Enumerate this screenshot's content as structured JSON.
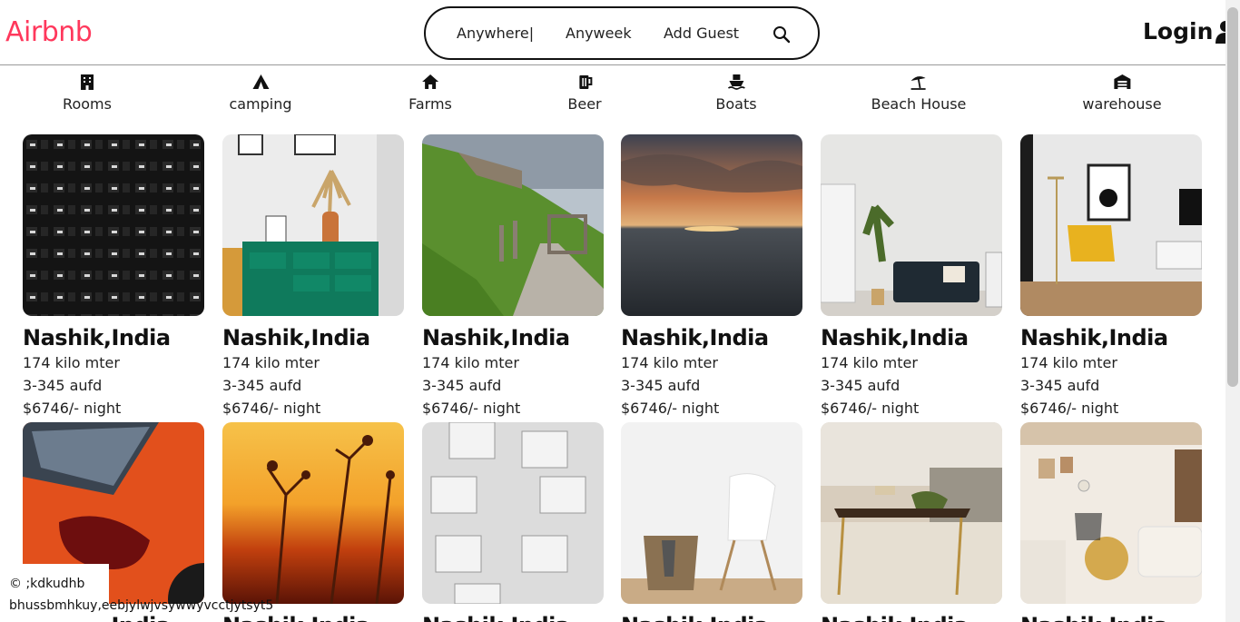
{
  "header": {
    "logo": "Airbnb",
    "search": {
      "anywhere": "Anywhere|",
      "anyweek": "Anyweek",
      "guest": "Add Guest"
    },
    "login": "Login"
  },
  "categories": [
    {
      "label": "Rooms",
      "icon": "building-icon"
    },
    {
      "label": "camping",
      "icon": "tent-icon"
    },
    {
      "label": "Farms",
      "icon": "house-icon"
    },
    {
      "label": "Beer",
      "icon": "mug-icon"
    },
    {
      "label": "Boats",
      "icon": "boat-icon"
    },
    {
      "label": "Beach House",
      "icon": "umbrella-icon"
    },
    {
      "label": "warehouse",
      "icon": "warehouse-icon"
    }
  ],
  "listings": [
    {
      "title": "Nashik,India",
      "distance": "174 kilo mter",
      "dates": "3-345 aufd",
      "price": "$6746/- night",
      "image": "dark-building"
    },
    {
      "title": "Nashik,India",
      "distance": "174 kilo mter",
      "dates": "3-345 aufd",
      "price": "$6746/- night",
      "image": "green-cabinet"
    },
    {
      "title": "Nashik,India",
      "distance": "174 kilo mter",
      "dates": "3-345 aufd",
      "price": "$6746/- night",
      "image": "hill-ruins"
    },
    {
      "title": "Nashik,India",
      "distance": "174 kilo mter",
      "dates": "3-345 aufd",
      "price": "$6746/- night",
      "image": "ocean-sunset"
    },
    {
      "title": "Nashik,India",
      "distance": "174 kilo mter",
      "dates": "3-345 aufd",
      "price": "$6746/- night",
      "image": "living-sofa"
    },
    {
      "title": "Nashik,India",
      "distance": "174 kilo mter",
      "dates": "3-345 aufd",
      "price": "$6746/- night",
      "image": "yellow-chair"
    },
    {
      "title": "Nashik,India",
      "image": "orange-car"
    },
    {
      "title": "Nashik,India",
      "image": "golden-field"
    },
    {
      "title": "Nashik,India",
      "image": "white-balconies"
    },
    {
      "title": "Nashik,India",
      "image": "white-chair"
    },
    {
      "title": "Nashik,India",
      "image": "coffee-table"
    },
    {
      "title": "Nashik,India",
      "image": "bright-lounge"
    }
  ],
  "footer": {
    "copyright": "© ;kdkudhb",
    "text": "bhussbmhkuy,eebjylwjvsywwyvcctjytsyt5"
  }
}
